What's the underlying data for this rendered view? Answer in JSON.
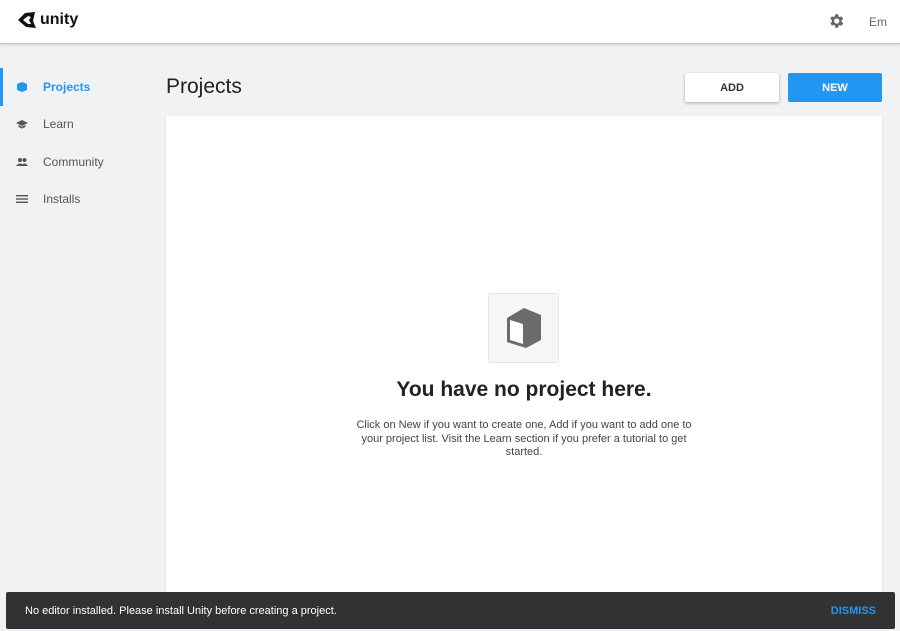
{
  "header": {
    "logo_text": "unity",
    "user": "Em"
  },
  "sidebar": {
    "items": [
      {
        "label": "Projects",
        "icon": "cube-icon"
      },
      {
        "label": "Learn",
        "icon": "graduation-cap-icon"
      },
      {
        "label": "Community",
        "icon": "people-icon"
      },
      {
        "label": "Installs",
        "icon": "list-icon"
      }
    ]
  },
  "main": {
    "title": "Projects",
    "add_label": "ADD",
    "new_label": "NEW",
    "empty_title": "You have no project here.",
    "empty_desc": "Click on New if you want to create one, Add if you want to add one to your project list. Visit the Learn section if you prefer a tutorial to get started."
  },
  "snackbar": {
    "message": "No editor installed. Please install Unity before creating a project.",
    "dismiss": "DISMISS"
  },
  "colors": {
    "accent": "#2196f3",
    "snackbar": "#323232"
  }
}
